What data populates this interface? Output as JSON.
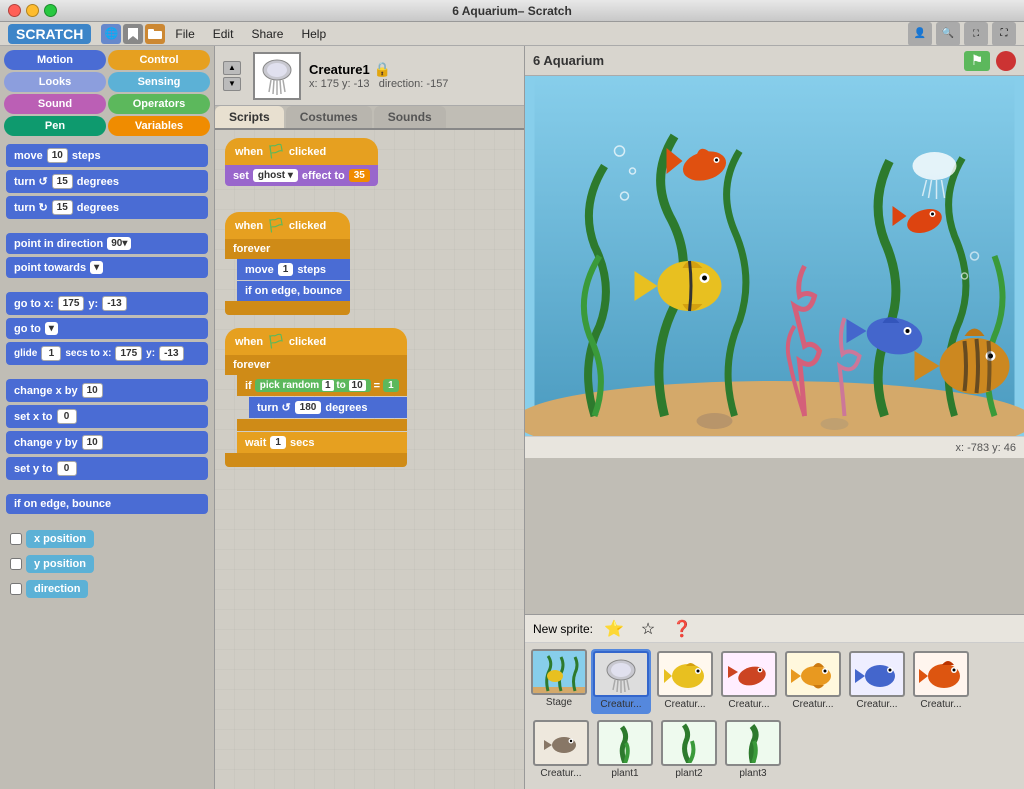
{
  "window": {
    "title": "6 Aquarium– Scratch",
    "logo": "SCRATCH"
  },
  "menu": {
    "file": "File",
    "edit": "Edit",
    "share": "Share",
    "help": "Help"
  },
  "sprite": {
    "name": "Creature1",
    "x": "x: 175",
    "y": "y: -13",
    "direction": "direction: -157"
  },
  "tabs": {
    "scripts": "Scripts",
    "costumes": "Costumes",
    "sounds": "Sounds"
  },
  "categories": [
    {
      "label": "Motion",
      "class": "cat-motion"
    },
    {
      "label": "Control",
      "class": "cat-control"
    },
    {
      "label": "Looks",
      "class": "cat-looks"
    },
    {
      "label": "Sensing",
      "class": "cat-sensing"
    },
    {
      "label": "Sound",
      "class": "cat-sound"
    },
    {
      "label": "Operators",
      "class": "cat-operators"
    },
    {
      "label": "Pen",
      "class": "cat-pen"
    },
    {
      "label": "Variables",
      "class": "cat-variables"
    }
  ],
  "blocks": [
    {
      "label": "move 10 steps",
      "class": "block-motion"
    },
    {
      "label": "turn ↺ 15 degrees",
      "class": "block-motion"
    },
    {
      "label": "turn ↻ 15 degrees",
      "class": "block-motion"
    },
    {
      "label": "point in direction 90▾",
      "class": "block-motion"
    },
    {
      "label": "point towards ▾",
      "class": "block-motion"
    },
    {
      "label": "go to x: 175 y: -13",
      "class": "block-motion"
    },
    {
      "label": "go to ▾",
      "class": "block-motion"
    },
    {
      "label": "glide 1 secs to x: 175 y: -13",
      "class": "block-motion"
    },
    {
      "label": "change x by 10",
      "class": "block-motion"
    },
    {
      "label": "set x to 0",
      "class": "block-motion"
    },
    {
      "label": "change y by 10",
      "class": "block-motion"
    },
    {
      "label": "set y to 0",
      "class": "block-motion"
    },
    {
      "label": "if on edge, bounce",
      "class": "block-motion"
    },
    {
      "label": "x position",
      "class": "block-sensing",
      "checkbox": true
    },
    {
      "label": "y position",
      "class": "block-sensing",
      "checkbox": true
    },
    {
      "label": "direction",
      "class": "block-sensing",
      "checkbox": true
    }
  ],
  "scripts": [
    {
      "blocks": [
        {
          "text": "when 🏳 clicked",
          "type": "hat-yellow"
        },
        {
          "text": "set ghost ▾ effect to 35",
          "type": "purple"
        }
      ]
    },
    {
      "blocks": [
        {
          "text": "when 🏳 clicked",
          "type": "hat-yellow"
        },
        {
          "text": "forever",
          "type": "orange-c"
        },
        {
          "text": "move 1 steps",
          "type": "blue-indent"
        },
        {
          "text": "if on edge, bounce",
          "type": "blue-indent"
        }
      ]
    },
    {
      "blocks": [
        {
          "text": "when 🏳 clicked",
          "type": "hat-yellow"
        },
        {
          "text": "forever",
          "type": "orange-c"
        },
        {
          "text": "if pick random 1 to 10 = 1",
          "type": "orange-indent"
        },
        {
          "text": "turn ↺ 180 degrees",
          "type": "blue-indent2"
        },
        {
          "text": "wait 1 secs",
          "type": "orange-indent"
        }
      ]
    }
  ],
  "stage": {
    "title": "6 Aquarium",
    "coords": "x: -783  y: 46"
  },
  "newSprite": {
    "label": "New sprite:"
  },
  "sprites": [
    {
      "label": "Creatur...",
      "selected": true
    },
    {
      "label": "Creatur..."
    },
    {
      "label": "Creatur..."
    },
    {
      "label": "Creatur..."
    },
    {
      "label": "Creatur..."
    },
    {
      "label": "Creatur..."
    },
    {
      "label": "Creatur..."
    },
    {
      "label": "plant1"
    },
    {
      "label": "plant2"
    },
    {
      "label": "plant3"
    }
  ]
}
